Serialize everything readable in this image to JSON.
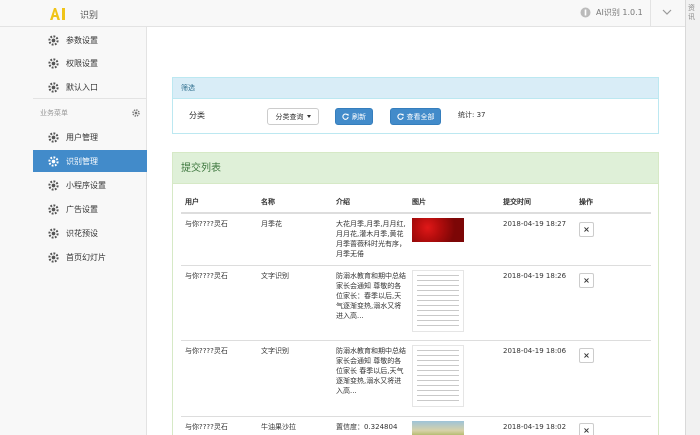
{
  "header": {
    "title": "识别",
    "version": "AI识别 1.0.1"
  },
  "right_strip": {
    "text": "资讯"
  },
  "sidebar": {
    "items_top": [
      {
        "label": "参数设置"
      },
      {
        "label": "权限设置"
      },
      {
        "label": "默认入口"
      }
    ],
    "group_label": "业务菜单",
    "items": [
      {
        "label": "用户管理",
        "active": false
      },
      {
        "label": "识别管理",
        "active": true
      },
      {
        "label": "小程序设置",
        "active": false
      },
      {
        "label": "广告设置",
        "active": false
      },
      {
        "label": "识花预设",
        "active": false
      },
      {
        "label": "首页幻灯片",
        "active": false
      }
    ]
  },
  "filter": {
    "header": "筛选",
    "label": "分类",
    "dropdown": "分类查询",
    "refresh_label": "刷新",
    "view_all_label": "查看全部",
    "stat": "统计: 37"
  },
  "list": {
    "title": "提交列表",
    "columns": [
      "用户",
      "名称",
      "介绍",
      "图片",
      "提交时间",
      "操作"
    ],
    "rows": [
      {
        "user": "与你????灵石",
        "name": "月季花",
        "intro": "大花月季,月季,月月红,月月花,灌木月季,黄花月季蔷薇科时光有序，月季无倦",
        "time": "2018-04-19 18:27",
        "pic": "flowers"
      },
      {
        "user": "与你????灵石",
        "name": "文字识别",
        "intro": "防溺水教育和期中总结家长会通知 尊敬的各位家长：春季以后,天气逐渐变热,溺水又将进入高...",
        "time": "2018-04-19 18:26",
        "pic": "doc"
      },
      {
        "user": "与你????灵石",
        "name": "文字识别",
        "intro": "防溺水教育和期中总结家长会通知 尊敬的各位家长 春季以后,天气逐渐变热,溺水又将进入高...",
        "time": "2018-04-19 18:06",
        "pic": "doc"
      },
      {
        "user": "与你????灵石",
        "name": "牛油果沙拉",
        "intro": "置信度：0.324804",
        "time": "2018-04-19 18:02",
        "pic": "food"
      }
    ]
  },
  "colors": {
    "primary": "#428bca",
    "info_bg": "#d9edf7",
    "success_bg": "#dff0d8"
  }
}
